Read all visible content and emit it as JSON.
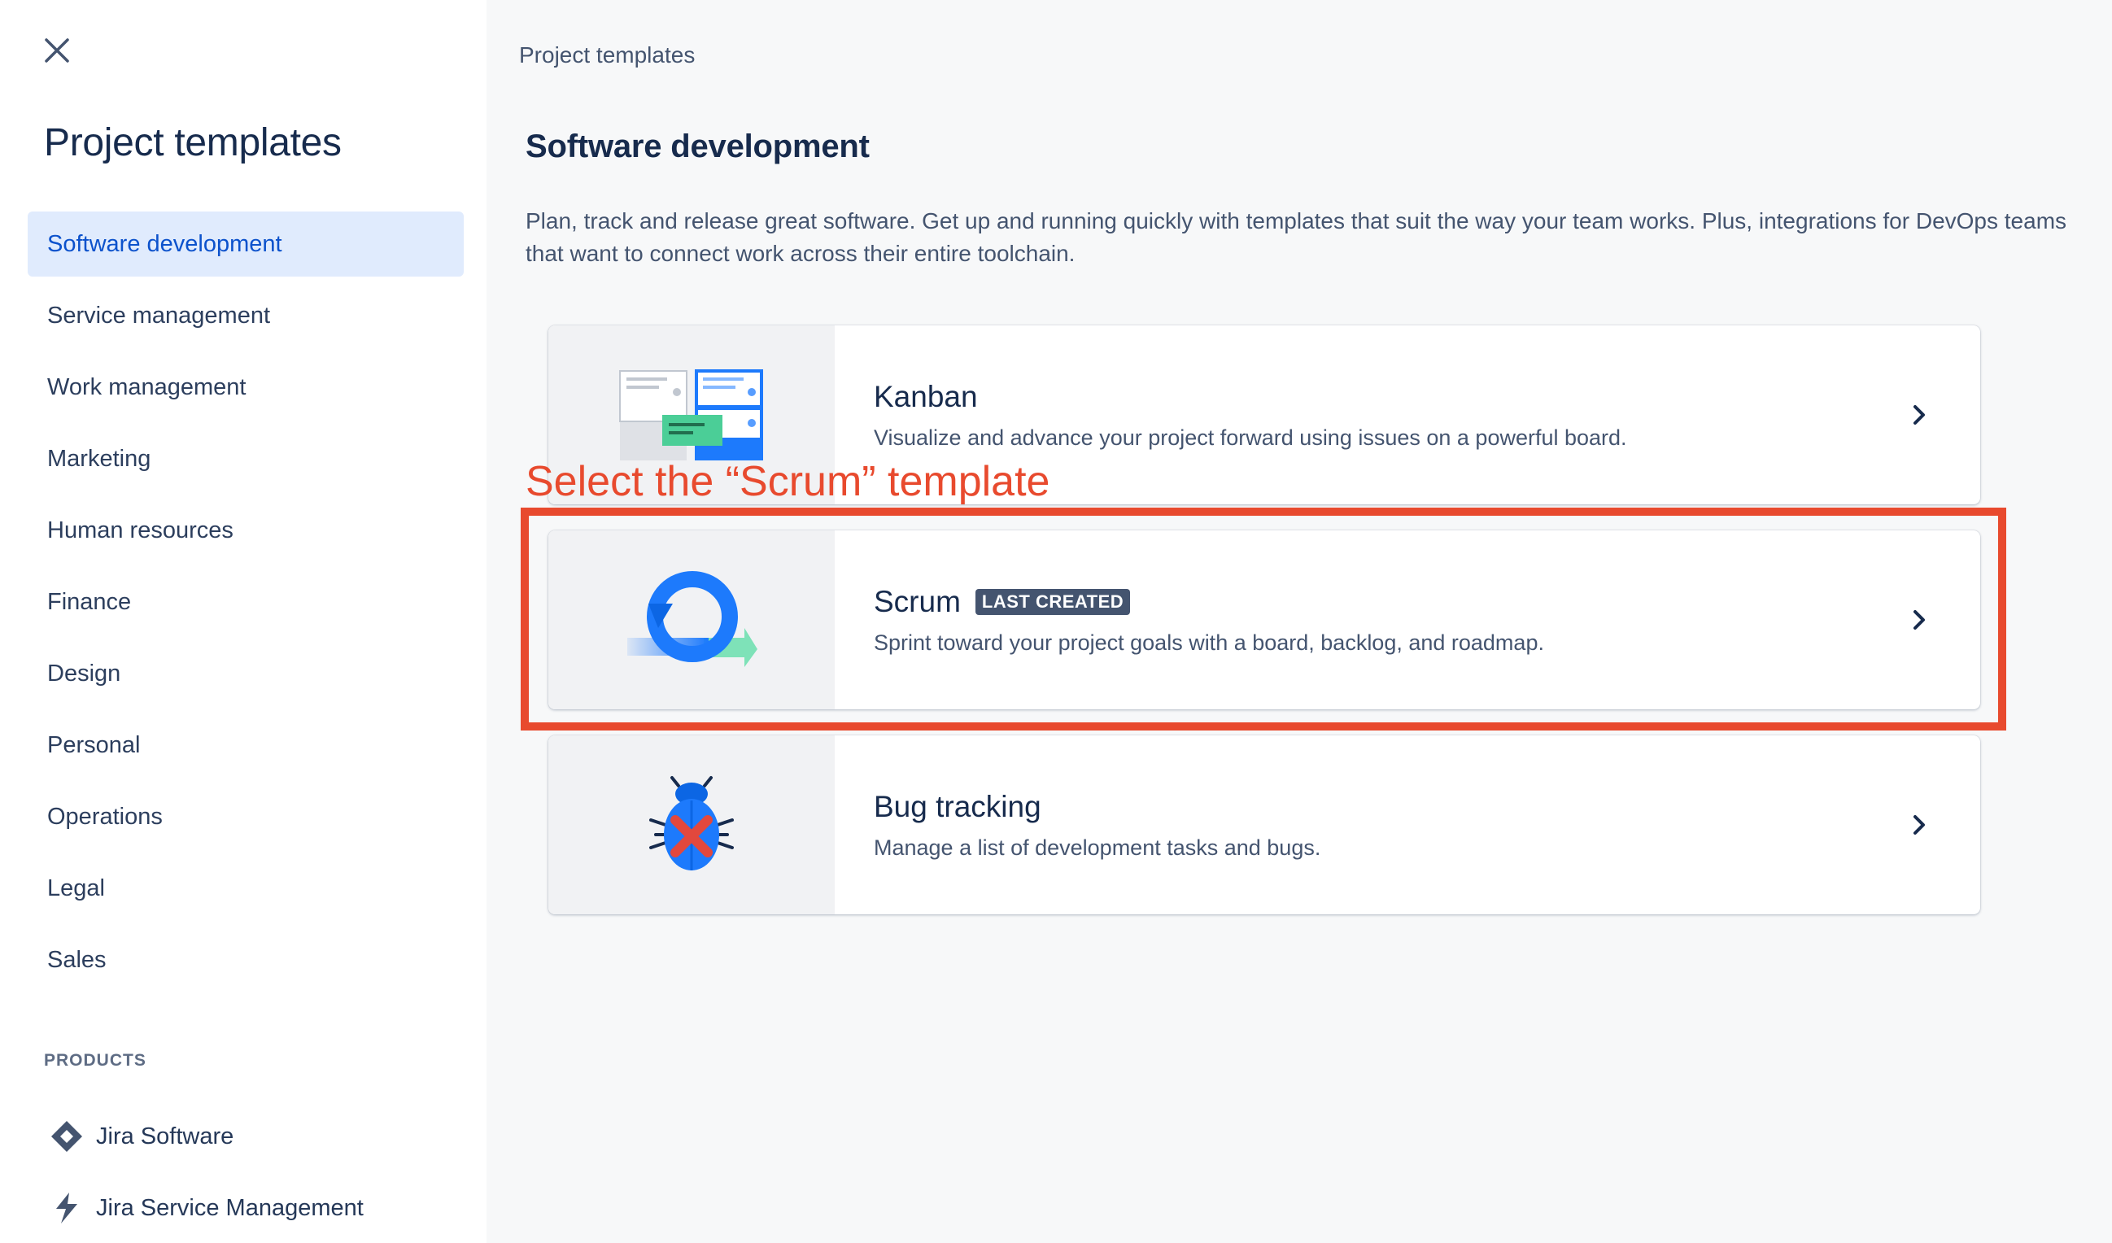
{
  "sidebar": {
    "title": "Project templates",
    "items": [
      {
        "label": "Software development",
        "active": true
      },
      {
        "label": "Service management"
      },
      {
        "label": "Work management"
      },
      {
        "label": "Marketing"
      },
      {
        "label": "Human resources"
      },
      {
        "label": "Finance"
      },
      {
        "label": "Design"
      },
      {
        "label": "Personal"
      },
      {
        "label": "Operations"
      },
      {
        "label": "Legal"
      },
      {
        "label": "Sales"
      }
    ],
    "products_label": "PRODUCTS",
    "products": [
      {
        "label": "Jira Software",
        "icon": "jira-software-icon"
      },
      {
        "label": "Jira Service Management",
        "icon": "jira-service-management-icon"
      }
    ]
  },
  "main": {
    "breadcrumb": "Project templates",
    "title": "Software development",
    "description": "Plan, track and release great software. Get up and running quickly with templates that suit the way your team works. Plus, integrations for DevOps teams that want to connect work across their entire toolchain.",
    "templates": [
      {
        "title": "Kanban",
        "description": "Visualize and advance your project forward using issues on a powerful board.",
        "icon": "kanban-illustration"
      },
      {
        "title": "Scrum",
        "badge": "LAST CREATED",
        "description": "Sprint toward your project goals with a board, backlog, and roadmap.",
        "icon": "scrum-illustration"
      },
      {
        "title": "Bug tracking",
        "description": "Manage a list of development tasks and bugs.",
        "icon": "bug-illustration"
      }
    ]
  },
  "annotation": {
    "text": "Select the “Scrum” template",
    "color": "#e84a2e"
  },
  "colors": {
    "accent": "#0c52cc",
    "active_bg": "#e0ebfd",
    "main_bg": "#f7f8f9"
  }
}
